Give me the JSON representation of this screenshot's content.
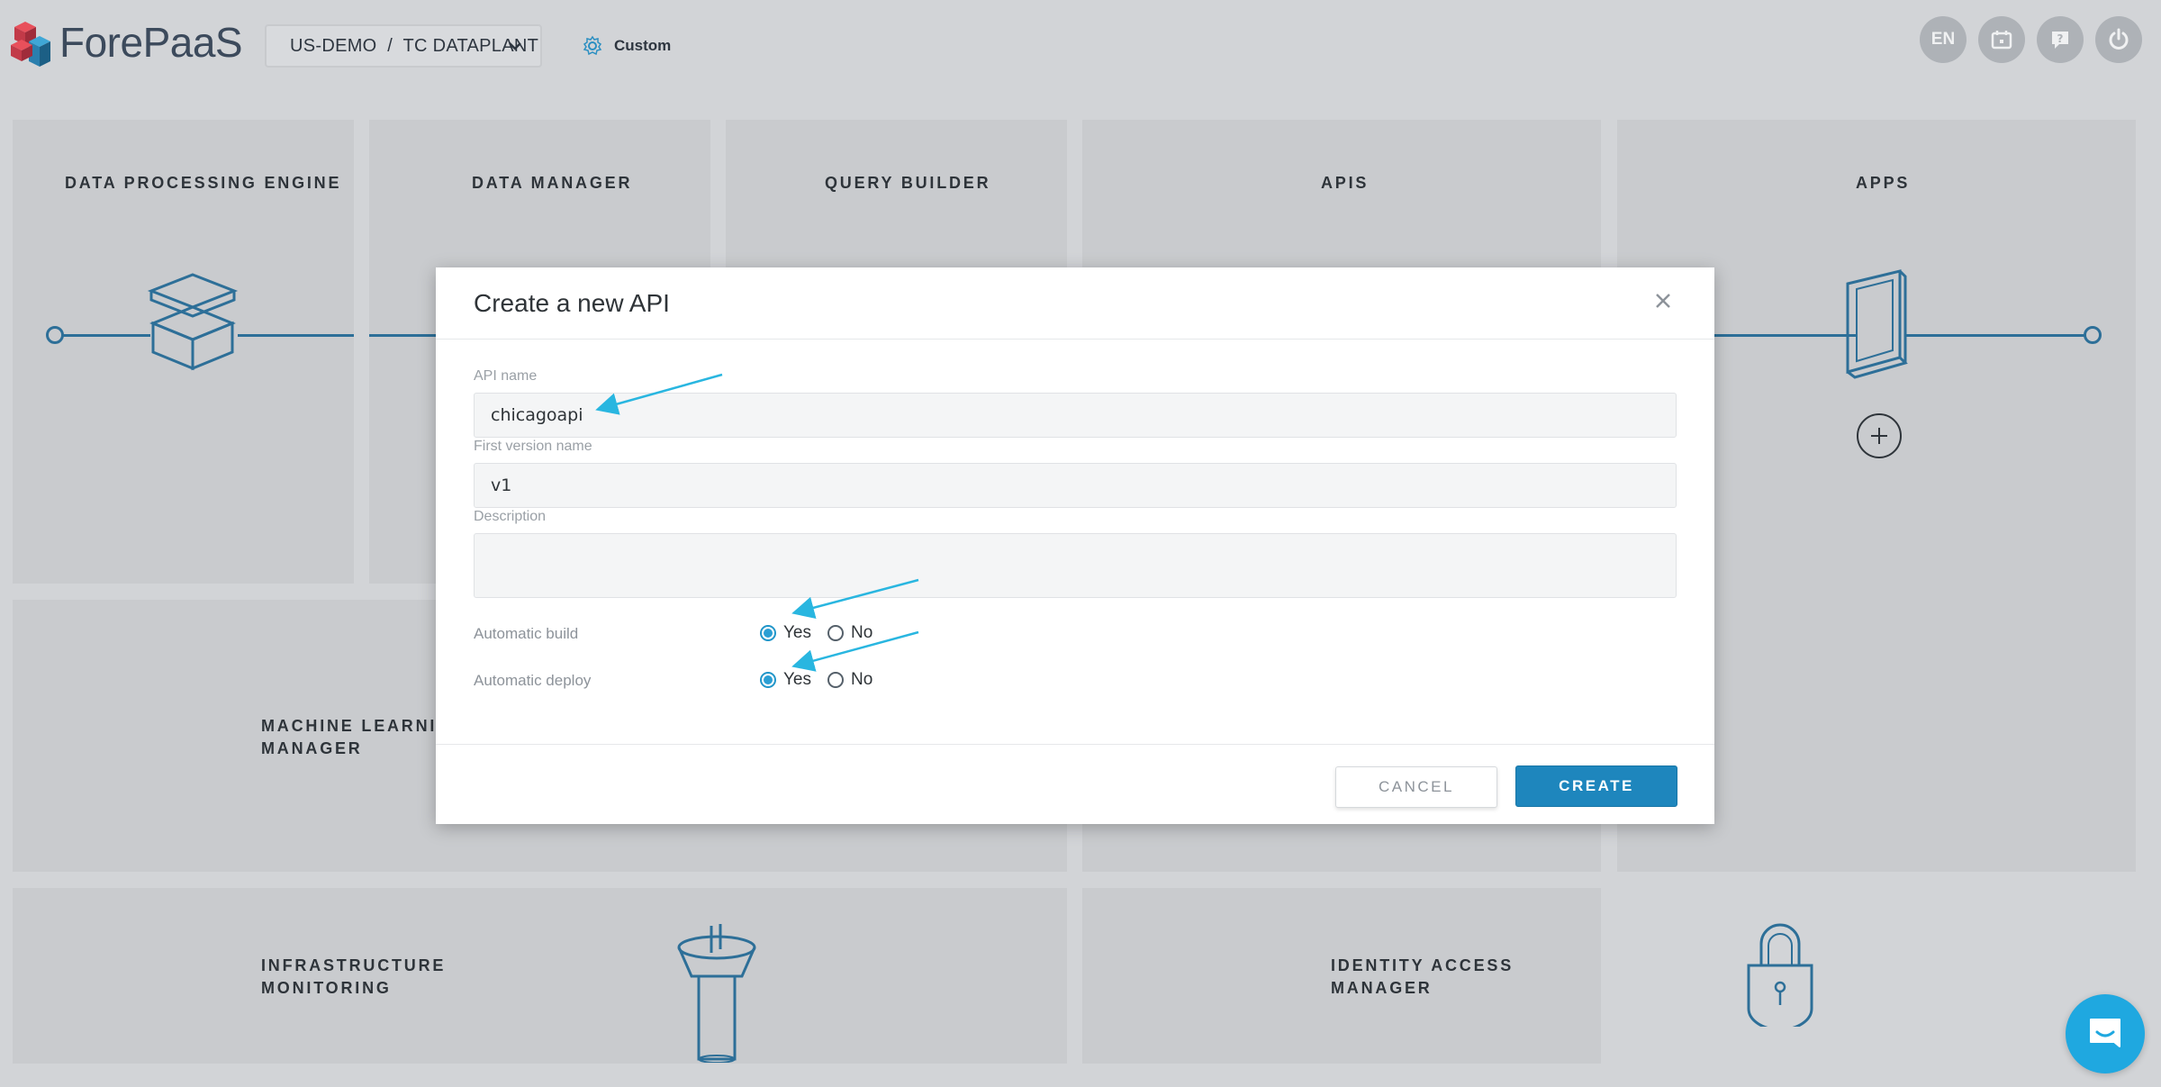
{
  "header": {
    "brand": "ForePaaS",
    "project": "US-DEMO  /  TC DATAPLANT",
    "custom_label": "Custom",
    "lang_label": "EN"
  },
  "tiles": {
    "data_processing_engine": "DATA PROCESSING ENGINE",
    "data_manager": "DATA MANAGER",
    "query_builder": "QUERY BUILDER",
    "apis": "APIS",
    "apps": "APPS",
    "ml_manager_line1": "MACHINE LEARNING",
    "ml_manager_line2": "MANAGER",
    "infra_line1": "INFRASTRUCTURE",
    "infra_line2": "MONITORING",
    "iam_line1": "IDENTITY ACCESS",
    "iam_line2": "MANAGER"
  },
  "modal": {
    "title": "Create a new API",
    "api_name_label": "API name",
    "api_name_value": "chicagoapi",
    "version_label": "First version name",
    "version_value": "v1",
    "description_label": "Description",
    "description_value": "",
    "auto_build_label": "Automatic build",
    "auto_deploy_label": "Automatic deploy",
    "yes_label": "Yes",
    "no_label": "No",
    "auto_build_selected": "Yes",
    "auto_deploy_selected": "Yes",
    "cancel_label": "CANCEL",
    "create_label": "CREATE"
  },
  "colors": {
    "accent": "#1e86bd",
    "annotation_arrow": "#29b6e0",
    "pipeline": "#2d6f98"
  }
}
